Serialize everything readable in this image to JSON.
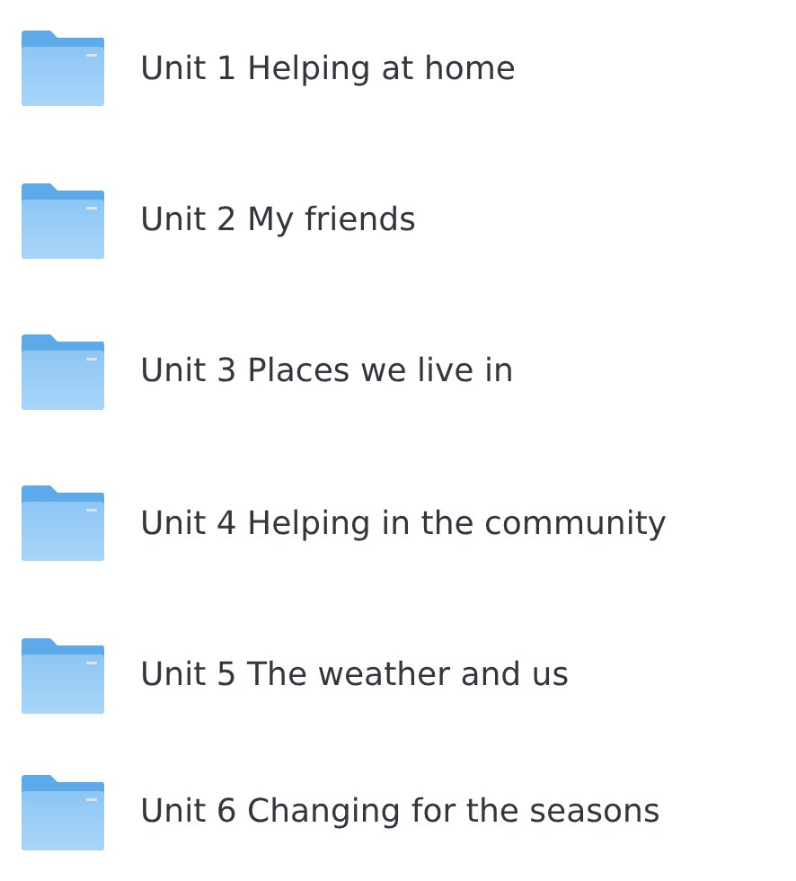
{
  "folders": [
    {
      "name": "Unit 1 Helping at home"
    },
    {
      "name": "Unit 2 My friends"
    },
    {
      "name": "Unit 3 Places we live in"
    },
    {
      "name": "Unit 4 Helping in the community"
    },
    {
      "name": "Unit 5 The weather and us"
    },
    {
      "name": "Unit 6 Changing for the seasons"
    }
  ]
}
